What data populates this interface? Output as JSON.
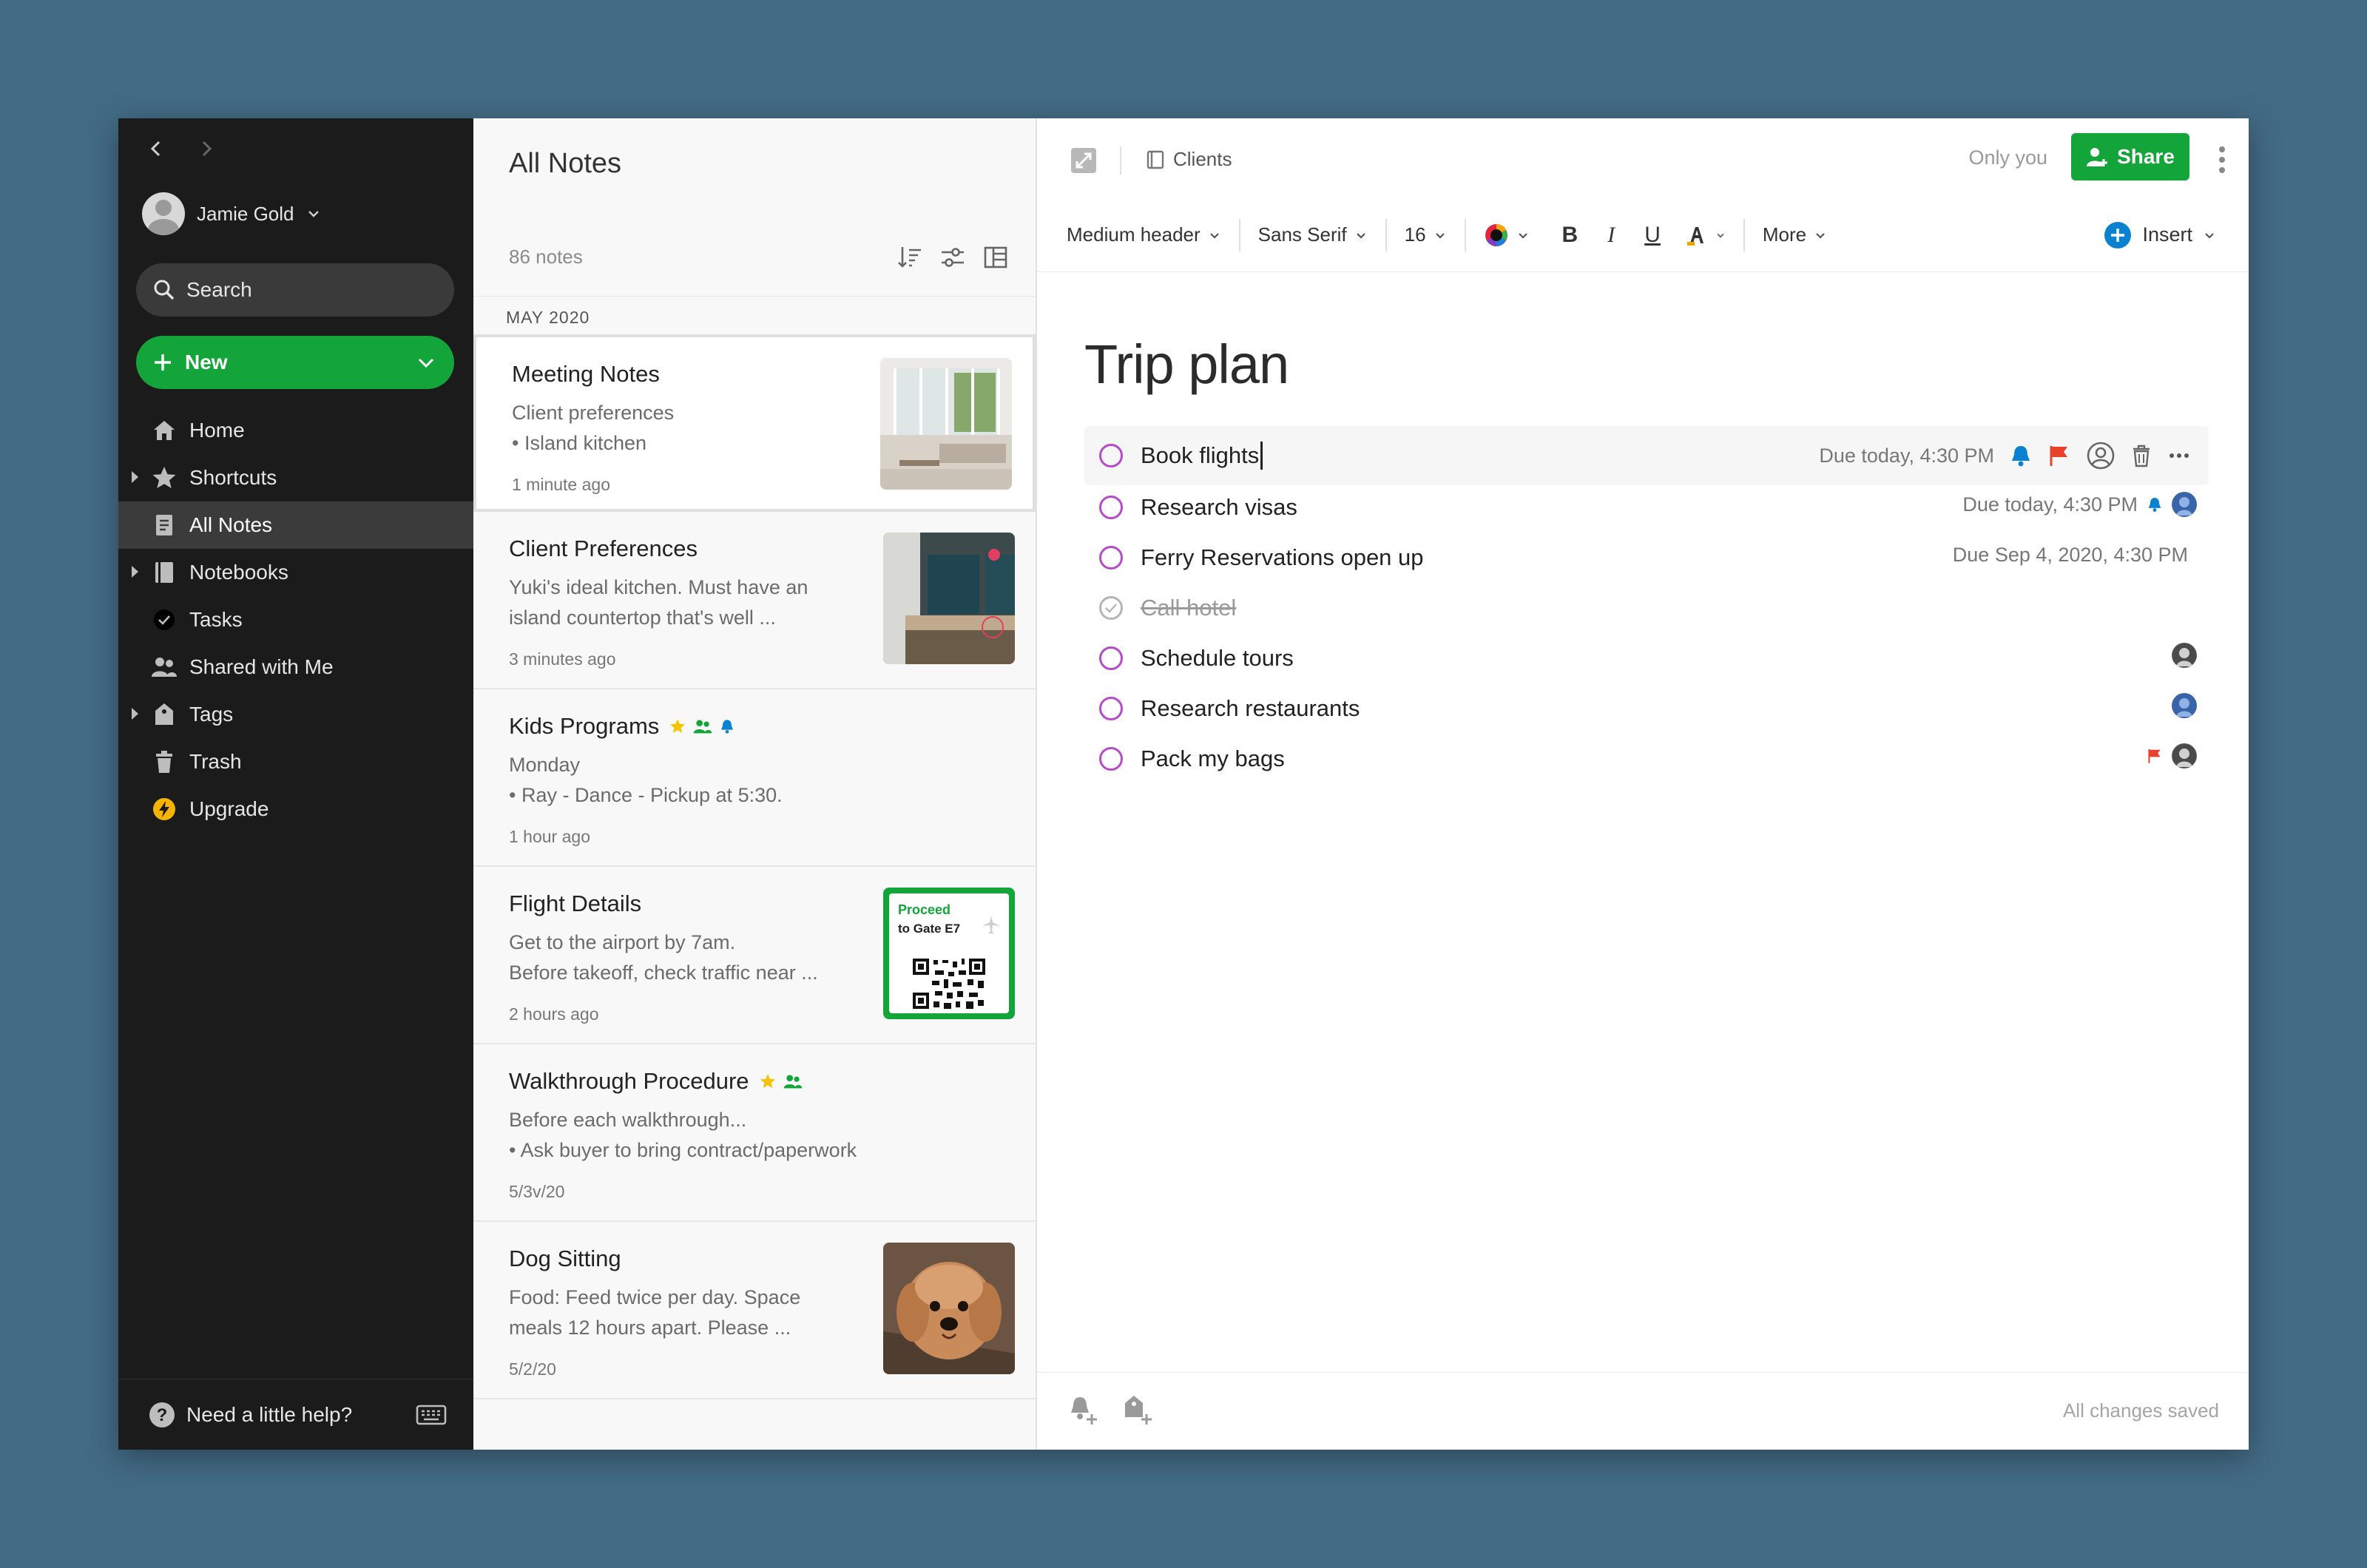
{
  "sidebar": {
    "user_name": "Jamie Gold",
    "search_label": "Search",
    "new_label": "New",
    "items": [
      {
        "label": "Home"
      },
      {
        "label": "Shortcuts"
      },
      {
        "label": "All Notes"
      },
      {
        "label": "Notebooks"
      },
      {
        "label": "Tasks"
      },
      {
        "label": "Shared with Me"
      },
      {
        "label": "Tags"
      },
      {
        "label": "Trash"
      },
      {
        "label": "Upgrade"
      }
    ],
    "help_label": "Need a little help?"
  },
  "notelist": {
    "title": "All Notes",
    "count": "86 notes",
    "month": "MAY 2020",
    "notes": [
      {
        "title": "Meeting Notes",
        "line1": "Client preferences",
        "line2": "• Island kitchen",
        "time": "1 minute ago"
      },
      {
        "title": "Client Preferences",
        "line1": "Yuki's ideal kitchen. Must have an",
        "line2": "island countertop that's well ...",
        "time": "3 minutes ago"
      },
      {
        "title": "Kids Programs",
        "line1": "Monday",
        "line2": "• Ray - Dance - Pickup at 5:30.",
        "time": "1 hour ago"
      },
      {
        "title": "Flight Details",
        "line1": "Get to the airport by 7am.",
        "line2": "Before takeoff, check traffic near ...",
        "time": "2 hours ago",
        "thumb_line1": "Proceed",
        "thumb_line2": "to Gate E7"
      },
      {
        "title": "Walkthrough Procedure",
        "line1": "Before each walkthrough...",
        "line2": "•  Ask buyer to bring contract/paperwork",
        "time": "5/3v/20"
      },
      {
        "title": "Dog Sitting",
        "line1": "Food: Feed twice per day. Space",
        "line2": "meals 12 hours apart. Please ...",
        "time": "5/2/20"
      }
    ]
  },
  "editor": {
    "notebook": "Clients",
    "only_you": "Only you",
    "share_label": "Share",
    "toolbar": {
      "style": "Medium header",
      "font": "Sans Serif",
      "size": "16",
      "bold": "B",
      "italic": "I",
      "underline": "U",
      "more": "More",
      "insert": "Insert"
    },
    "title": "Trip plan",
    "tasks": [
      {
        "label": "Book flights",
        "due": "Due today, 4:30 PM"
      },
      {
        "label": "Research visas",
        "due": "Due today, 4:30 PM"
      },
      {
        "label": "Ferry Reservations open up",
        "due": "Due Sep 4, 2020, 4:30 PM"
      },
      {
        "label": "Call hotel",
        "due": ""
      },
      {
        "label": "Schedule tours",
        "due": ""
      },
      {
        "label": "Research restaurants",
        "due": ""
      },
      {
        "label": "Pack my bags",
        "due": ""
      }
    ],
    "status": "All changes saved"
  },
  "colors": {
    "accent_green": "#14a53a",
    "sidebar_bg": "#1b1b1b",
    "task_circle": "#b54cc8",
    "flag_red": "#e8412c",
    "reminder_blue": "#0b82cf",
    "star_yellow": "#f5c400"
  }
}
